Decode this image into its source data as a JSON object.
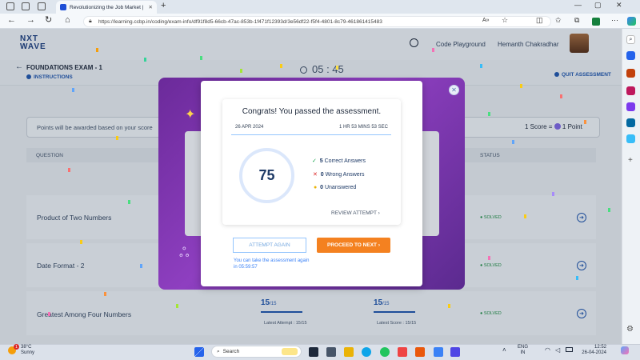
{
  "browser": {
    "tab_title": "Revolutionizing the Job Market |",
    "url": "https://learning.ccbp.in/coding/exam-info/df91f8d5-66cb-47ac-853b-1f471f12393d/3e56df22-f5f4-4801-8c79-461861415483"
  },
  "header": {
    "logo_line1": "NXT",
    "logo_line2": "WAVE",
    "playground": "Code Playground",
    "user_name": "Hemanth Chakradhar"
  },
  "exam": {
    "title": "FOUNDATIONS EXAM - 1",
    "instructions": "INSTRUCTIONS",
    "timer": "05 : 45",
    "quit": "QUIT ASSESSMENT"
  },
  "info": {
    "points_text": "Points will be awarded based on your score",
    "score_rule": "1 Score = ",
    "score_rule_end": " 1 Point"
  },
  "table": {
    "col_question": "QUESTION",
    "col_status": "STATUS",
    "rows": [
      {
        "name": "Product of Two Numbers",
        "status": "SOLVED"
      },
      {
        "name": "Date Format - 2",
        "status": "SOLVED"
      },
      {
        "name": "Greatest Among Four Numbers",
        "status": "SOLVED",
        "score_a": "15",
        "score_a_total": "/15",
        "score_b": "15",
        "score_b_total": "/15",
        "latest_attempt": "Latest Attempt : 15/15",
        "latest_score": "Latest Score : 15/15"
      }
    ]
  },
  "modal": {
    "heading": "Congrats! You passed the assessment.",
    "date": "26 APR 2024",
    "duration": "1 HR 53 MINS 53 SEC",
    "score": "75",
    "correct_count": "5",
    "correct_label": "Correct Answers",
    "wrong_count": "0",
    "wrong_label": "Wrong Answers",
    "unanswered_count": "0",
    "unanswered_label": "Unanswered",
    "review": "REVIEW ATTEMPT",
    "attempt_again": "ATTEMPT AGAIN",
    "proceed": "PROCEED TO NEXT",
    "retake_note": "You can take the assessment again in 05:59:57"
  },
  "taskbar": {
    "temp": "38°C",
    "weather": "Sunny",
    "badge": "1",
    "search": "Search",
    "lang1": "ENG",
    "lang2": "IN",
    "time": "12:52",
    "date": "26-04-2024"
  }
}
